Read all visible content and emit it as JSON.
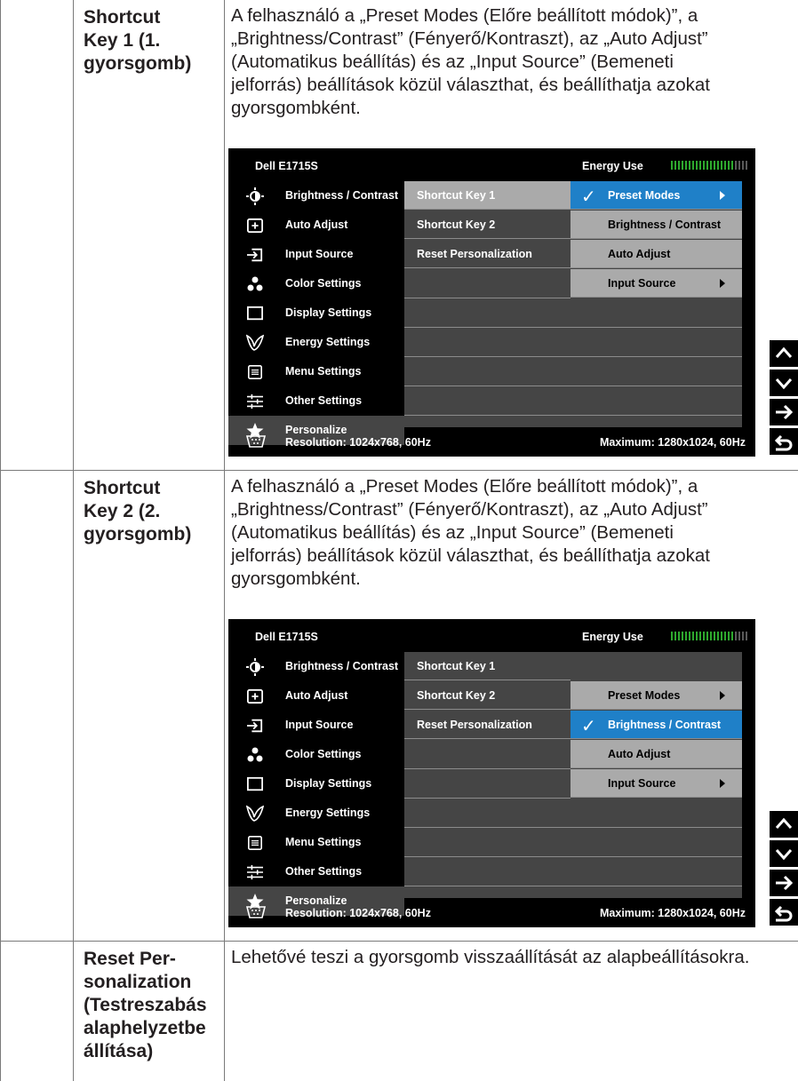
{
  "rows": [
    {
      "label": "Shortcut Key 1 (1. gyorsgomb)",
      "label_lines": [
        "Shortcut",
        "Key 1 (1.",
        "gyorsgomb)"
      ],
      "desc_lines": [
        "A felhasználó a „Preset Modes (Előre beállított módok)”, a",
        "„Brightness/Contrast” (Fényerő/Kontraszt), az „Auto Adjust”",
        "(Automatikus beállítás) és az „Input Source” (Bemeneti",
        "jelforrás) beállítások közül választhat, és beállíthatja azokat",
        "gyorsgombként."
      ]
    },
    {
      "label": "Shortcut Key 2 (2. gyorsgomb)",
      "label_lines": [
        "Shortcut",
        "Key 2 (2.",
        "gyorsgomb)"
      ],
      "desc_lines": [
        "A felhasználó a „Preset Modes (Előre beállított módok)”, a",
        "„Brightness/Contrast” (Fényerő/Kontraszt), az „Auto Adjust”",
        "(Automatikus beállítás) és az „Input Source” (Bemeneti",
        "jelforrás) beállítások közül választhat, és beállíthatja azokat",
        "gyorsgombként."
      ]
    },
    {
      "label": "Reset Personalization (Testreszabás alaphelyzetbe állítása)",
      "label_lines": [
        "Reset Per-",
        "sonalization",
        "(Testreszabás",
        "alaphelyzetbe",
        "állítása)"
      ],
      "desc_lines": [
        "Lehetővé teszi a gyorsgomb visszaállítását az alapbeállításokra."
      ]
    }
  ],
  "osd": {
    "title": "Dell E1715S",
    "energy_label": "Energy Use",
    "energy_level": 0.8,
    "menu_items": [
      {
        "label": "Brightness / Contrast",
        "icon": "brightness-icon"
      },
      {
        "label": "Auto Adjust",
        "icon": "auto-adjust-icon"
      },
      {
        "label": "Input Source",
        "icon": "input-source-icon"
      },
      {
        "label": "Color Settings",
        "icon": "color-settings-icon"
      },
      {
        "label": "Display Settings",
        "icon": "display-settings-icon"
      },
      {
        "label": "Energy Settings",
        "icon": "energy-leaf-icon"
      },
      {
        "label": "Menu Settings",
        "icon": "menu-settings-icon"
      },
      {
        "label": "Other Settings",
        "icon": "other-settings-icon"
      },
      {
        "label": "Personalize",
        "icon": "star-icon"
      }
    ],
    "sub_items": [
      "Shortcut Key 1",
      "Shortcut Key 2",
      "Reset Personalization"
    ],
    "options": [
      {
        "label": "Preset Modes",
        "has_arrow": true
      },
      {
        "label": "Brightness / Contrast",
        "has_arrow": false
      },
      {
        "label": "Auto Adjust",
        "has_arrow": false
      },
      {
        "label": "Input Source",
        "has_arrow": true
      }
    ],
    "resolution": "Resolution: 1024x768, 60Hz",
    "maximum": "Maximum: 1280x1024, 60Hz",
    "check_glyph": "✓"
  },
  "osd_states": [
    {
      "selected_sub": 0,
      "options_start_row": 0,
      "checked_option": 0
    },
    {
      "selected_sub": -1,
      "options_start_row": 1,
      "checked_option": 1
    }
  ],
  "nav_buttons": [
    "up-icon",
    "down-icon",
    "right-arrow-icon",
    "back-icon"
  ],
  "colors": {
    "highlight": "#1f80c8",
    "panel": "#454545",
    "option_bg": "#aaaaaa",
    "energy_green": "#2ea82e"
  }
}
